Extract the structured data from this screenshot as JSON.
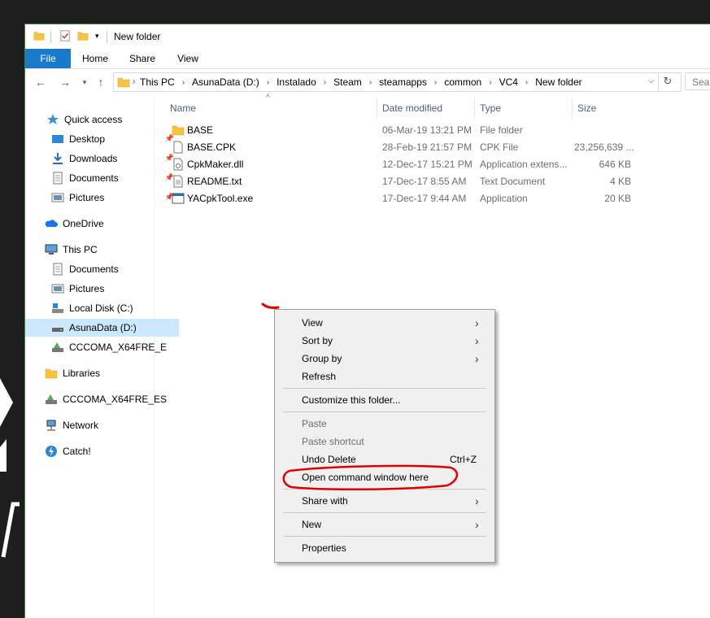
{
  "window": {
    "title": "New folder",
    "tabs": [
      "File",
      "Home",
      "Share",
      "View"
    ]
  },
  "address": {
    "crumbs": [
      "This PC",
      "AsunaData (D:)",
      "Instalado",
      "Steam",
      "steamapps",
      "common",
      "VC4",
      "New folder"
    ],
    "search_placeholder": "Sear"
  },
  "nav": {
    "quick_access": "Quick access",
    "desktop": "Desktop",
    "downloads": "Downloads",
    "documents": "Documents",
    "pictures": "Pictures",
    "onedrive": "OneDrive",
    "this_pc": "This PC",
    "pc_documents": "Documents",
    "pc_pictures": "Pictures",
    "local_disk": "Local Disk (C:)",
    "asuna": "AsunaData (D:)",
    "cccoma1": "CCCOMA_X64FRE_E",
    "libraries": "Libraries",
    "cccoma2": "CCCOMA_X64FRE_ES",
    "network": "Network",
    "catch": "Catch!"
  },
  "columns": {
    "name": "Name",
    "date": "Date modified",
    "type": "Type",
    "size": "Size"
  },
  "files": [
    {
      "name": "BASE",
      "date": "06-Mar-19 13:21 PM",
      "type": "File folder",
      "size": "",
      "icon": "folder-icon"
    },
    {
      "name": "BASE.CPK",
      "date": "28-Feb-19 21:57 PM",
      "type": "CPK File",
      "size": "23,256,639 ...",
      "icon": "file-icon"
    },
    {
      "name": "CpkMaker.dll",
      "date": "12-Dec-17 15:21 PM",
      "type": "Application extens...",
      "size": "646 KB",
      "icon": "dll-icon"
    },
    {
      "name": "README.txt",
      "date": "17-Dec-17 8:55 AM",
      "type": "Text Document",
      "size": "4 KB",
      "icon": "text-file-icon"
    },
    {
      "name": "YACpkTool.exe",
      "date": "17-Dec-17 9:44 AM",
      "type": "Application",
      "size": "20 KB",
      "icon": "exe-icon"
    }
  ],
  "context_menu": {
    "view": "View",
    "sort_by": "Sort by",
    "group_by": "Group by",
    "refresh": "Refresh",
    "customize": "Customize this folder...",
    "paste": "Paste",
    "paste_shortcut": "Paste shortcut",
    "undo_delete": "Undo Delete",
    "undo_shortcut": "Ctrl+Z",
    "open_cmd": "Open command window here",
    "share_with": "Share with",
    "new": "New",
    "properties": "Properties"
  },
  "colors": {
    "accent": "#1979ca",
    "selection": "#cce8ff",
    "annotation": "#e00000",
    "folder": "#f5c542"
  }
}
